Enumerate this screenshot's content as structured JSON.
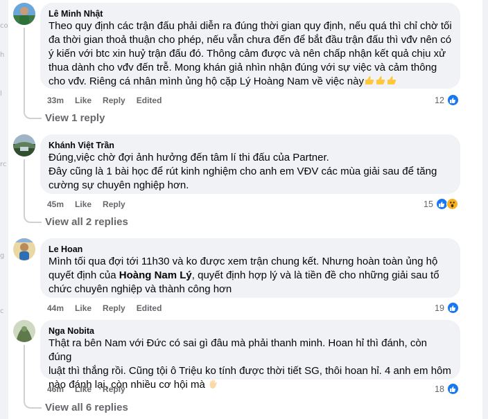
{
  "comments": [
    {
      "author": "Lê Minh Nhật",
      "lines": [
        "Theo quy định các trận đấu phải diễn ra đúng thời gian quy định, nếu quá thì chỉ chờ tối",
        "đa thời gian thoả thuận cho phép, nếu vẫn chưa đến để bắt đầu trận đấu thì vđv nên có",
        "ý kiến với btc xin huỷ trận đấu đó. Thông cảm được và nên chấp nhận kết quả chịu xử",
        "thua dành cho vđv đến trễ. Mong khán giả nhìn nhận đúng với sự việc và cảm thông",
        "cho vđv. Riêng cá nhân mình ủng hộ cặp Lý Hoàng Nam về việc này"
      ],
      "time": "33m",
      "like_label": "Like",
      "reply_label": "Reply",
      "edited_label": "Edited",
      "reaction_count": "12",
      "view_replies": "View 1 reply"
    },
    {
      "author": "Khánh Việt Trần",
      "lines": [
        "Đúng,việc chờ đợi ảnh hưởng đến tâm lí thi đấu của Partner.",
        "Đây cũng là 1 bài học để rút kinh nghiệm cho anh em VĐV các mùa giải sau để tăng",
        "cường sự chuyên nghiệp hơn."
      ],
      "time": "45m",
      "like_label": "Like",
      "reply_label": "Reply",
      "reaction_count": "15",
      "view_replies": "View all 2 replies"
    },
    {
      "author": "Le Hoan",
      "line1": "Mình tối qua đợi tới 11h30 và ko được xem trận chung kết. Nhưng hoàn toàn ủng hộ",
      "line2_pre": "quyết định của ",
      "line2_bold": "Hoàng Nam Lý",
      "line2_post": ", quyết định hợp lý và là tiền đề cho những giải sau tổ",
      "line3": "chức chuyên nghiệp và thành công hơn",
      "time": "44m",
      "like_label": "Like",
      "reply_label": "Reply",
      "edited_label": "Edited",
      "reaction_count": "19"
    },
    {
      "author": "Nga Nobita",
      "lines": [
        "Thật ra bên Nam với Đức có sai gì đâu mà phải thanh minh. Hoan hỉ thì đánh, còn đúng",
        "luật thì thắng rồi. Cũng tội ô Triệu ko tính được thời tiết SG, thôi hoan hỉ. 4 anh em hôm",
        "nào đánh lại, còn nhiều cơ hội mà"
      ],
      "time": "46m",
      "like_label": "Like",
      "reply_label": "Reply",
      "reaction_count": "18",
      "view_replies": "View all 6 replies"
    }
  ],
  "left_strip": [
    "co",
    "h",
    "l",
    "rc",
    "g",
    "c"
  ],
  "colors": {
    "bubble": "#f0f2f5",
    "meta": "#65676b",
    "like": "#1877f2",
    "wow": "#f7b125"
  },
  "icons": [
    "like-reaction-icon",
    "wow-reaction-icon",
    "thumbs-up-emoji-icon",
    "waving-hand-emoji-icon"
  ]
}
